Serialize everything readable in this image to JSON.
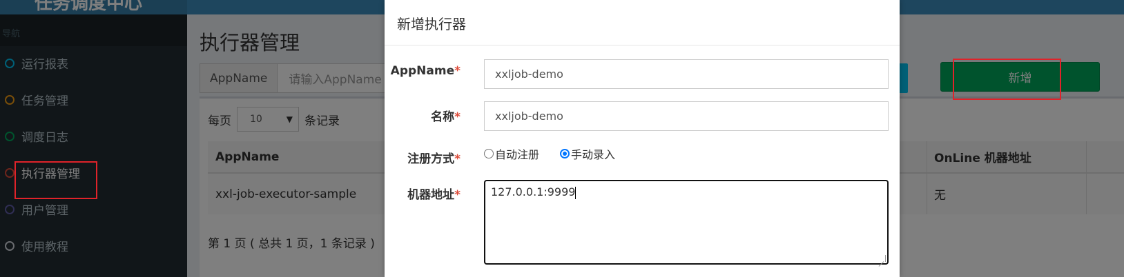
{
  "app": {
    "title": "任务调度中心"
  },
  "sidebar": {
    "header": "导航",
    "items": [
      {
        "label": "运行报表",
        "color": "#00c0ef"
      },
      {
        "label": "任务管理",
        "color": "#f39c12"
      },
      {
        "label": "调度日志",
        "color": "#00a65a"
      },
      {
        "label": "执行器管理",
        "color": "#dd4b39",
        "active": true
      },
      {
        "label": "用户管理",
        "color": "#605ca8"
      },
      {
        "label": "使用教程",
        "color": "#d2d6de"
      }
    ]
  },
  "main": {
    "title": "执行器管理",
    "search": {
      "label": "AppName",
      "placeholder": "请输入AppName"
    },
    "add_button": "新增",
    "length": {
      "prefix": "每页",
      "value": "10",
      "suffix": "条记录"
    },
    "table": {
      "headers": {
        "appname": "AppName",
        "online": "OnLine 机器地址"
      },
      "rows": [
        {
          "appname": "xxl-job-executor-sample",
          "online": "无"
        }
      ]
    },
    "paging": "第 1 页 ( 总共 1 页，1 条记录 )"
  },
  "modal": {
    "title": "新增执行器",
    "fields": {
      "appname": {
        "label": "AppName",
        "value": "xxljob-demo"
      },
      "title": {
        "label": "名称",
        "value": "xxljob-demo"
      },
      "register_type": {
        "label": "注册方式",
        "options": [
          {
            "label": "自动注册",
            "checked": false
          },
          {
            "label": "手动录入",
            "checked": true
          }
        ]
      },
      "address": {
        "label": "机器地址",
        "value": "127.0.0.1:9999"
      }
    },
    "required_mark": "*"
  },
  "colors": {
    "header": "#3c8dbc",
    "sidebar": "#222d32",
    "success": "#00a65a",
    "info": "#00c0ef",
    "highlight": "#e0232a"
  }
}
